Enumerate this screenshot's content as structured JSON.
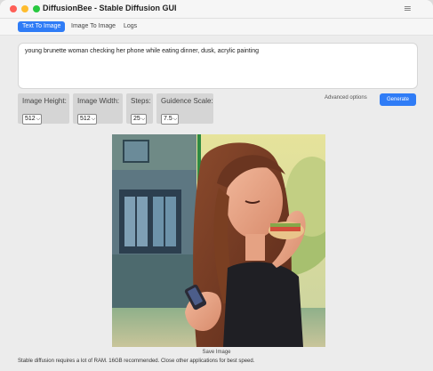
{
  "window": {
    "title": "DiffusionBee - Stable Diffusion GUI",
    "menu_icon": "hamburger-menu-icon"
  },
  "tabs": [
    {
      "label": "Text To Image",
      "active": true
    },
    {
      "label": "Image To Image",
      "active": false
    },
    {
      "label": "Logs",
      "active": false
    }
  ],
  "prompt": {
    "value": "young brunette woman checking her phone while eating dinner, dusk, acrylic painting"
  },
  "params": {
    "height": {
      "label": "Image Height:",
      "value": "512"
    },
    "width": {
      "label": "Image Width:",
      "value": "512"
    },
    "steps": {
      "label": "Steps:",
      "value": "25"
    },
    "guidance": {
      "label": "Guidence Scale:",
      "value": "7.5"
    }
  },
  "advanced_label": "Advanced options",
  "generate_label": "Generate",
  "save_label": "Save Image",
  "footer_note": "Stable diffusion requires a lot of RAM. 16GB recommended. Close other applications for best speed.",
  "colors": {
    "accent": "#2f7cf6",
    "traffic_red": "#fe5f57",
    "traffic_yellow": "#febc2e",
    "traffic_green": "#28c840"
  }
}
